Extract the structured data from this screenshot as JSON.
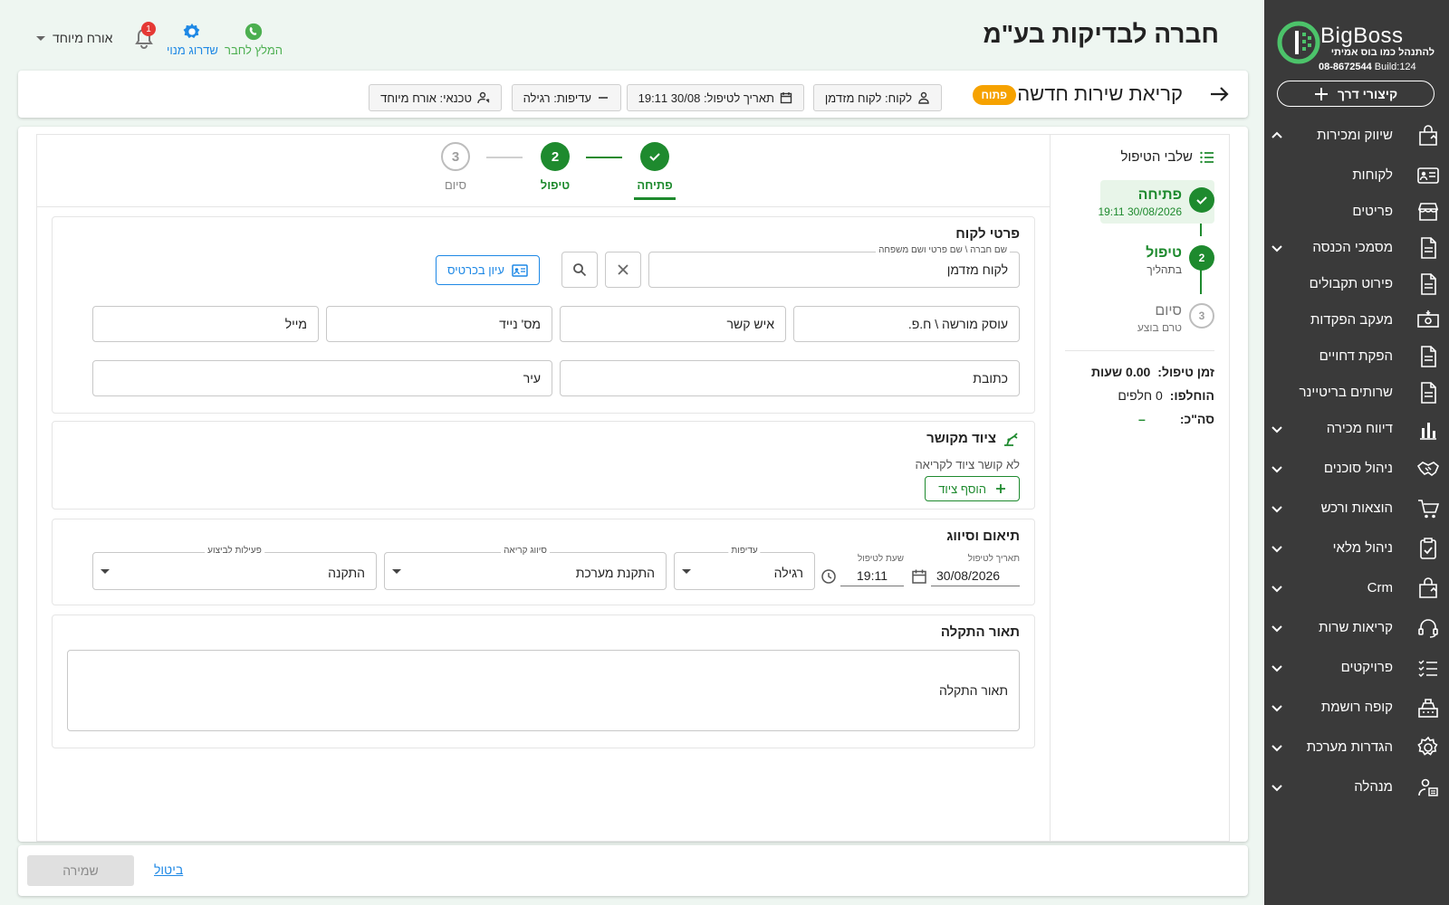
{
  "company": {
    "title": "חברה לבדיקות בע\"מ"
  },
  "top_actions": {
    "recommend": "המלץ לחבר",
    "upgrade": "שדרוג מנוי",
    "notifications_count": "1",
    "user": "אורח מיוחד"
  },
  "sidebar": {
    "brand": "BigBoss",
    "slogan": "להתנהל כמו בוס אמיתי",
    "phone": "08-8672544",
    "build": "Build:124",
    "quick_label": "קיצורי דרך",
    "items": [
      {
        "label": "שיווק ומכירות",
        "icon": "bag-icon",
        "chevron": "up"
      },
      {
        "label": "לקוחות",
        "icon": "id-card-icon",
        "chevron": ""
      },
      {
        "label": "פריטים",
        "icon": "store-icon",
        "chevron": ""
      },
      {
        "label": "מסמכי הכנסה",
        "icon": "document-icon",
        "chevron": "down"
      },
      {
        "label": "פירוט תקבולים",
        "icon": "document-icon",
        "chevron": ""
      },
      {
        "label": "מעקב הפקדות",
        "icon": "money-icon",
        "chevron": ""
      },
      {
        "label": "הפקת דחויים",
        "icon": "document-icon",
        "chevron": ""
      },
      {
        "label": "שרותים בריטיינר",
        "icon": "document-icon",
        "chevron": ""
      },
      {
        "label": "דיווח מכירה",
        "icon": "bar-chart-icon",
        "chevron": "down"
      },
      {
        "label": "ניהול סוכנים",
        "icon": "handshake-icon",
        "chevron": "down"
      },
      {
        "label": "הוצאות ורכש",
        "icon": "cart-icon",
        "chevron": "down"
      },
      {
        "label": "ניהול מלאי",
        "icon": "clipboard-check-icon",
        "chevron": "down"
      },
      {
        "label": "Crm",
        "icon": "bag-icon",
        "chevron": "down"
      },
      {
        "label": "קריאות שרות",
        "icon": "headset-icon",
        "chevron": "down"
      },
      {
        "label": "פרויקטים",
        "icon": "checklist-icon",
        "chevron": "down"
      },
      {
        "label": "קופה רושמת",
        "icon": "cash-register-icon",
        "chevron": "down"
      },
      {
        "label": "הגדרות מערכת",
        "icon": "gear-icon",
        "chevron": "down"
      },
      {
        "label": "מנהלה",
        "icon": "manager-icon",
        "chevron": "down"
      }
    ]
  },
  "callbar": {
    "title": "קריאת שירות חדשה",
    "status": "פתוח",
    "chips": {
      "customer": "לקוח: לקוח מזדמן",
      "date": "תאריך לטיפול: 30/08 19:11",
      "priority": "עדיפות: רגילה",
      "technician": "טכנאי: אורח מיוחד"
    }
  },
  "steps_panel": {
    "header": "שלבי הטיפול",
    "steps": [
      {
        "num": "",
        "title": "פתיחה",
        "sub": "30/08/2026 19:11"
      },
      {
        "num": "2",
        "title": "טיפול",
        "sub": "בתהליך"
      },
      {
        "num": "3",
        "title": "סיום",
        "sub": "טרם בוצע"
      }
    ],
    "summary": {
      "time_label": "זמן טיפול:",
      "time_value": "0.00 שעות",
      "parts_label": "הוחלפו:",
      "parts_value": "0 חלפים",
      "total_label": "סה\"כ:",
      "total_value": "–"
    }
  },
  "stepper": [
    {
      "num": "",
      "label": "פתיחה"
    },
    {
      "num": "2",
      "label": "טיפול"
    },
    {
      "num": "3",
      "label": "סיום"
    }
  ],
  "customer_section": {
    "title": "פרטי לקוח",
    "search_label": "שם חברה \\ שם פרטי ושם משפחה",
    "search_value": "לקוח מזדמן",
    "view_card": "עיון בכרטיס",
    "fields": {
      "vat": "עוסק מורשה \\ ח.פ.",
      "contact": "איש קשר",
      "mobile": "מס' נייד",
      "email": "מייל",
      "address": "כתובת",
      "city": "עיר"
    }
  },
  "equipment_section": {
    "title": "ציוד מקושר",
    "empty": "לא קושר ציוד לקריאה",
    "add": "הוסף ציוד"
  },
  "scheduling_section": {
    "title": "תיאום וסיווג",
    "date_label": "תאריך לטיפול",
    "date_value": "30/08/2026",
    "time_label": "שעת לטיפול",
    "time_value": "19:11",
    "priority_label": "עדיפות",
    "priority_value": "רגילה",
    "class_label": "סיווג קריאה",
    "class_value": "התקנת מערכת",
    "action_label": "פעילות לביצוע",
    "action_value": "התקנה"
  },
  "problem_section": {
    "title": "תאור התקלה",
    "placeholder": "תאור התקלה"
  },
  "footer": {
    "save": "שמירה",
    "cancel": "ביטול"
  },
  "colors": {
    "sidebar_bg": "#3a3a3a",
    "green": "#1e8a2e",
    "blue": "#1e88e5",
    "status_orange": "#f6a200",
    "page_bg": "#eef6f1"
  }
}
